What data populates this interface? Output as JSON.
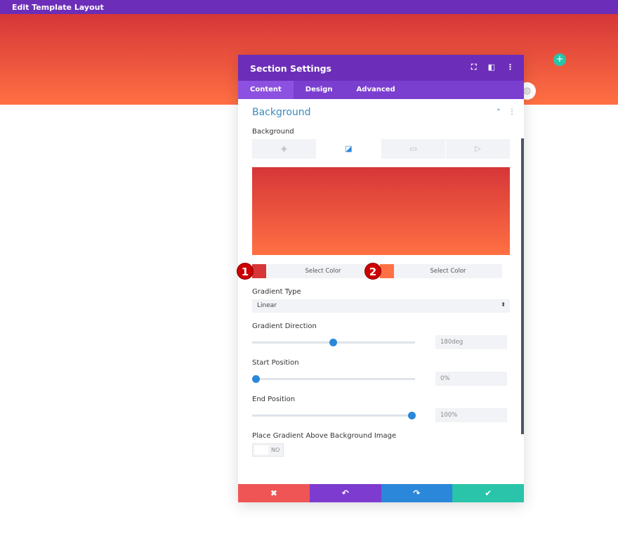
{
  "topbar": {
    "title": "Edit Template Layout"
  },
  "panel": {
    "title": "Section Settings",
    "tabs": [
      "Content",
      "Design",
      "Advanced"
    ],
    "active_tab": "Content"
  },
  "section": {
    "title": "Background"
  },
  "background": {
    "label": "Background",
    "types": [
      "color",
      "gradient",
      "image",
      "video"
    ],
    "active": "gradient"
  },
  "colors": [
    {
      "badge": "1",
      "label": "Select Color",
      "color": "#d63638"
    },
    {
      "badge": "2",
      "label": "Select Color",
      "color": "#ff7043"
    }
  ],
  "gradient_type": {
    "label": "Gradient Type",
    "value": "Linear"
  },
  "direction": {
    "label": "Gradient Direction",
    "value": "180deg",
    "fraction": 0.5
  },
  "start": {
    "label": "Start Position",
    "value": "0%",
    "fraction": 0
  },
  "end": {
    "label": "End Position",
    "value": "100%",
    "fraction": 1
  },
  "place_above": {
    "label": "Place Gradient Above Background Image",
    "value": "NO"
  },
  "colors_theme": {
    "header": "#6c2eb9",
    "accent": "#2b87da",
    "cancel": "#ef5555",
    "undo": "#7e3bd0",
    "redo": "#2b87da",
    "save": "#29c4a9"
  }
}
